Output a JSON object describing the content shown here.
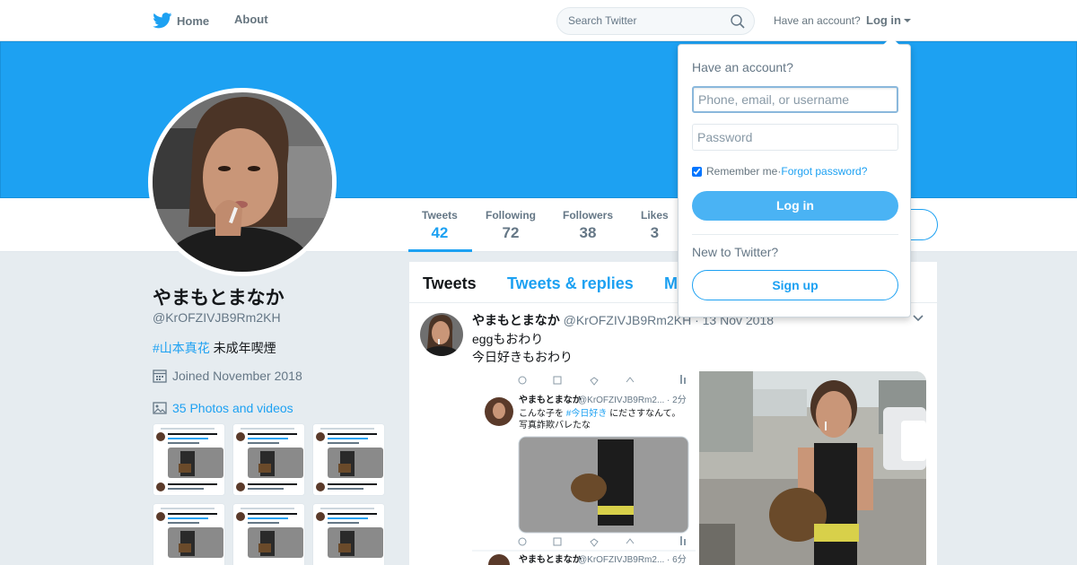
{
  "nav": {
    "home": "Home",
    "about": "About",
    "search_placeholder": "Search Twitter",
    "have_account": "Have an account?",
    "login": "Log in"
  },
  "profile": {
    "display_name": "やまもとまなか",
    "handle": "@KrOFZIVJB9Rm2KH",
    "bio_tag": "#山本真花",
    "bio_text": " 未成年喫煙",
    "joined": "Joined November 2018",
    "photos_link": "35 Photos and videos"
  },
  "stats": [
    {
      "label": "Tweets",
      "value": "42"
    },
    {
      "label": "Following",
      "value": "72"
    },
    {
      "label": "Followers",
      "value": "38"
    },
    {
      "label": "Likes",
      "value": "3"
    }
  ],
  "timeline": {
    "tabs": [
      "Tweets",
      "Tweets & replies",
      "M"
    ],
    "tweet": {
      "name": "やまもとまなか",
      "handle": "@KrOFZIVJB9Rm2KH",
      "date": "· 13 Nov 2018",
      "lines": [
        "eggもおわり",
        "今日好きもおわり"
      ]
    }
  },
  "login_dropdown": {
    "title": "Have an account?",
    "username_placeholder": "Phone, email, or username",
    "password_placeholder": "Password",
    "remember": "Remember me",
    "separator": " · ",
    "forgot": "Forgot password?",
    "login_button": "Log in",
    "new_to": "New to Twitter?",
    "signup_button": "Sign up"
  },
  "embedded_screenshot": {
    "name": "やまもとまなか",
    "handle_time": "@KrOFZIVJB9Rm2... · 2分",
    "line1_a": "こんな子を ",
    "line1_tag": "#今日好き",
    "line1_b": " にださすなんて。",
    "line2": "写真詐欺バレたな",
    "second_name": "やまもとまなか",
    "second_handle_time": "@KrOFZIVJB9Rm2... · 6分"
  },
  "colors": {
    "brand": "#1da1f2",
    "banner": "#1da1f2",
    "background": "#e6ecf0"
  }
}
